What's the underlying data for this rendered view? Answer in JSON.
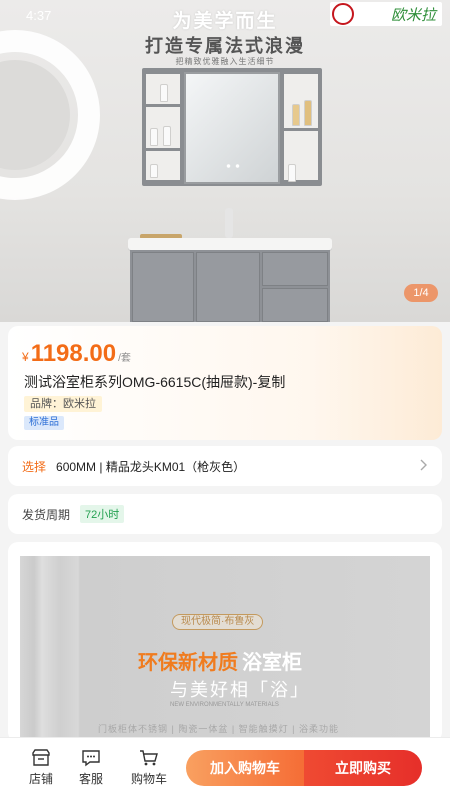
{
  "status_bar": {
    "time": "4:37"
  },
  "hero": {
    "headline": "为美学而生",
    "subheadline": "打造专属法式浪漫",
    "tagline": "把精致优雅融入生活细节",
    "brand_logo_text": "欧米拉",
    "pager": "1/4"
  },
  "product": {
    "currency": "¥",
    "price": "1198.00",
    "unit": "/套",
    "title": "测试浴室柜系列OMG-6615C(抽屉款)-复制",
    "brand_tag": "品牌：欧米拉",
    "standard_tag": "标准品"
  },
  "spec": {
    "label": "选择",
    "value": "600MM | 精品龙头KM01（枪灰色）"
  },
  "shipping": {
    "label": "发货周期",
    "value": "72小时"
  },
  "detail": {
    "pill": "现代极简·布鲁灰",
    "headline_a": "环保新材质",
    "headline_b": "浴室柜",
    "headline_c": "与美好相「浴」",
    "en_text": "NEW ENVIRONMENTALLY MATERIALS",
    "features": "门板柜体不锈钢 | 陶瓷一体盆 | 智能触摸灯 | 浴柔功能"
  },
  "bottom_bar": {
    "store": "店铺",
    "service": "客服",
    "cart": "购物车",
    "add_to_cart": "加入购物车",
    "buy_now": "立即购买"
  },
  "colors": {
    "accent": "#f36c17",
    "buy": "#e62f2a",
    "cart": "#f56d36",
    "ship_green": "#23a050",
    "std_blue": "#2d6fd6"
  },
  "icons": [
    "store-icon",
    "service-chat-icon",
    "shopping-cart-icon",
    "chevron-right-icon"
  ]
}
